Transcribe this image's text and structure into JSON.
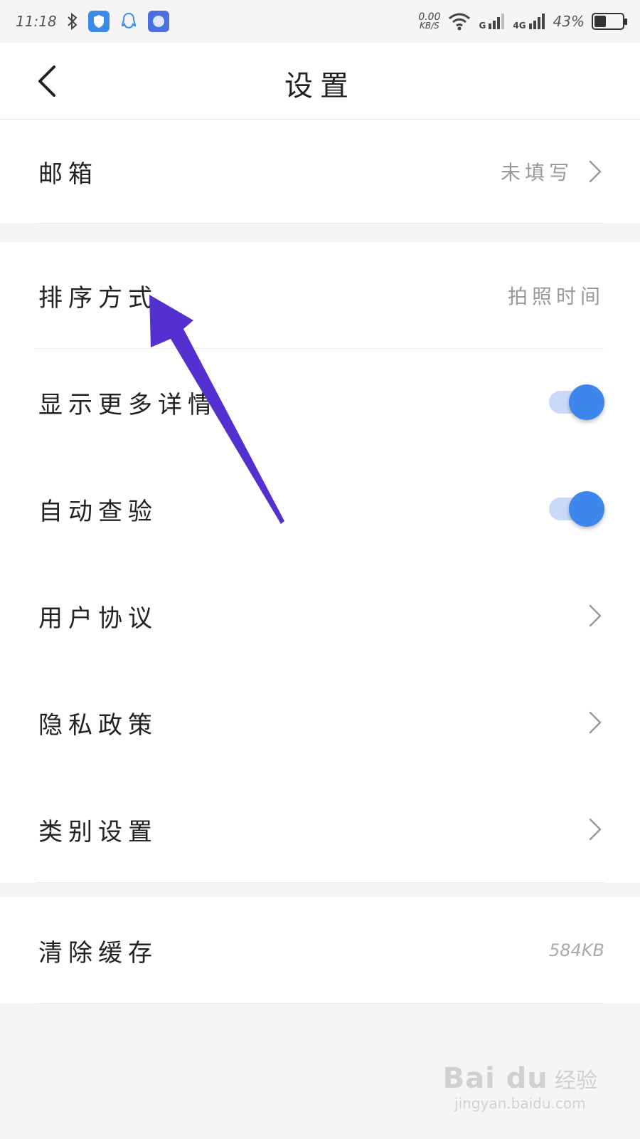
{
  "status_bar": {
    "time": "11:18",
    "speed_value": "0.00",
    "speed_unit": "KB/S",
    "network_g": "G",
    "network_4g": "4G",
    "battery": "43%",
    "battery_level": 0.43
  },
  "header": {
    "title": "设置"
  },
  "groups": [
    {
      "rows": [
        {
          "label": "邮箱",
          "value": "未填写",
          "type": "chevron"
        }
      ]
    },
    {
      "rows": [
        {
          "label": "排序方式",
          "value": "拍照时间",
          "type": "value"
        },
        {
          "label": "显示更多详情",
          "type": "toggle",
          "on": true
        },
        {
          "label": "自动查验",
          "type": "toggle",
          "on": true
        },
        {
          "label": "用户协议",
          "type": "chevron"
        },
        {
          "label": "隐私政策",
          "type": "chevron"
        },
        {
          "label": "类别设置",
          "type": "chevron"
        }
      ]
    },
    {
      "rows": [
        {
          "label": "清除缓存",
          "value": "584KB",
          "type": "value"
        }
      ]
    }
  ],
  "colors": {
    "accent": "#3c86ee",
    "toggle_track": "#c9d9f7",
    "annotation_arrow": "#5530d0"
  },
  "watermark": {
    "logo": "Bai du",
    "cn": "经验",
    "url": "jingyan.baidu.com"
  }
}
